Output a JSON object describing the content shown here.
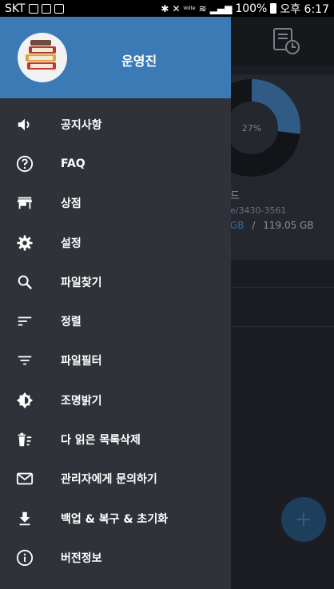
{
  "status_bar": {
    "carrier": "SKT",
    "battery": "100%",
    "time": "오후 6:17",
    "volte": "Volte"
  },
  "background_app": {
    "donut_percent": "27%",
    "donut_used_fraction": 0.27,
    "storage_name_partial": "드",
    "storage_path_partial": "e/3430-3561",
    "used_partial": "GB",
    "separator": "/",
    "total": "119.05 GB",
    "fab_label": "+",
    "accent_color": "#3b6d9c"
  },
  "drawer": {
    "header_color": "#3c7ab6",
    "user_name": "운영진",
    "items": [
      {
        "label": "공지사항",
        "icon": "volume-icon"
      },
      {
        "label": "FAQ",
        "icon": "help-icon"
      },
      {
        "label": "상점",
        "icon": "store-icon"
      },
      {
        "label": "설정",
        "icon": "gear-icon"
      },
      {
        "label": "파일찾기",
        "icon": "search-icon"
      },
      {
        "label": "정렬",
        "icon": "sort-icon"
      },
      {
        "label": "파일필터",
        "icon": "filter-icon"
      },
      {
        "label": "조명밝기",
        "icon": "brightness-icon"
      },
      {
        "label": "다 읽은 목록삭제",
        "icon": "delete-list-icon"
      },
      {
        "label": "관리자에게 문의하기",
        "icon": "mail-icon"
      },
      {
        "label": "백업 & 복구 & 초기화",
        "icon": "download-icon"
      },
      {
        "label": "버전정보",
        "icon": "info-icon"
      }
    ]
  }
}
